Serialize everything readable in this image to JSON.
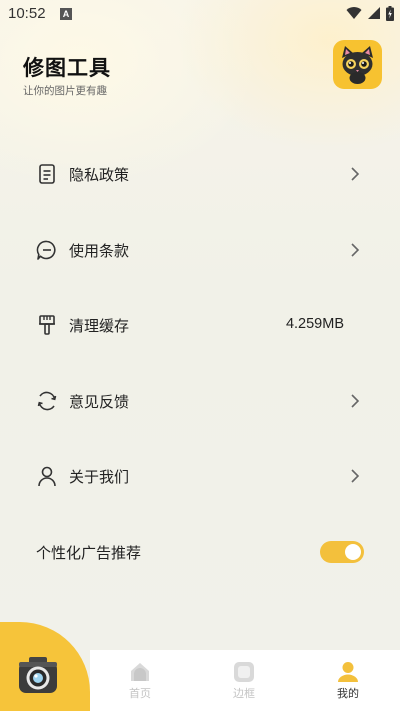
{
  "status_bar": {
    "time": "10:52",
    "notification_letter": "A"
  },
  "header": {
    "title": "修图工具",
    "subtitle": "让你的图片更有趣"
  },
  "menu": {
    "items": [
      {
        "label": "隐私政策",
        "icon": "document-icon",
        "has_chevron": true
      },
      {
        "label": "使用条款",
        "icon": "chat-bubble-icon",
        "has_chevron": true
      },
      {
        "label": "清理缓存",
        "icon": "brush-icon",
        "value": "4.259MB"
      },
      {
        "label": "意见反馈",
        "icon": "refresh-icon",
        "has_chevron": true
      },
      {
        "label": "关于我们",
        "icon": "person-icon",
        "has_chevron": true
      }
    ]
  },
  "ad_setting": {
    "label": "个性化广告推荐",
    "enabled": true
  },
  "tabs": [
    {
      "label": "首页",
      "icon": "home-icon",
      "active": false
    },
    {
      "label": "边框",
      "icon": "frame-icon",
      "active": false
    },
    {
      "label": "我的",
      "icon": "profile-icon",
      "active": true
    }
  ],
  "colors": {
    "accent": "#f3c03c",
    "background": "#f1f1ea"
  }
}
